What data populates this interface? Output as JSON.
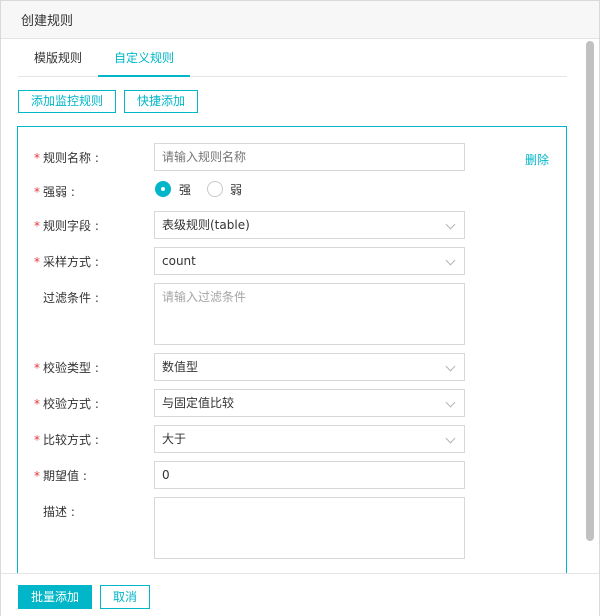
{
  "dialog": {
    "title": "创建规则"
  },
  "tabs": [
    {
      "label": "模版规则",
      "active": false
    },
    {
      "label": "自定义规则",
      "active": true
    }
  ],
  "toolbar": {
    "add_monitor_label": "添加监控规则",
    "quick_add_label": "快捷添加"
  },
  "rule": {
    "delete_label": "删除",
    "name": {
      "label": "规则名称 :",
      "value": "",
      "placeholder": "请输入规则名称"
    },
    "strength": {
      "label": "强弱 :",
      "options": [
        "强",
        "弱"
      ],
      "selected": "强"
    },
    "field": {
      "label": "规则字段 :",
      "value": "表级规则(table)"
    },
    "sampling": {
      "label": "采样方式 :",
      "value": "count"
    },
    "filter": {
      "label": "过滤条件 :",
      "value": "",
      "placeholder": "请输入过滤条件"
    },
    "check_type": {
      "label": "校验类型 :",
      "value": "数值型"
    },
    "check_method": {
      "label": "校验方式 :",
      "value": "与固定值比较"
    },
    "compare": {
      "label": "比较方式 :",
      "value": "大于"
    },
    "expected": {
      "label": "期望值 :",
      "value": "0"
    },
    "description": {
      "label": "描述 :",
      "value": ""
    }
  },
  "footer": {
    "batch_add_label": "批量添加",
    "cancel_label": "取消"
  },
  "colors": {
    "accent": "#00b6c8",
    "required": "#e4393c",
    "border": "#d8d8d8"
  }
}
